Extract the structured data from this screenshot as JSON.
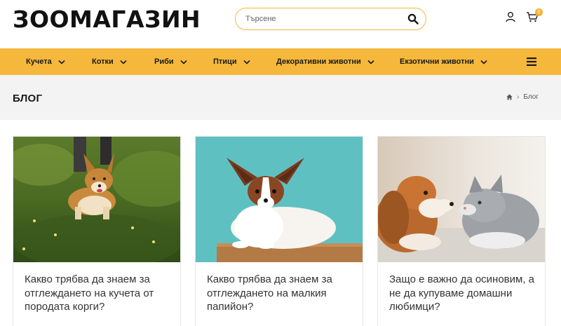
{
  "header": {
    "logo": "ЗООМАГАЗИН",
    "search": {
      "placeholder": "Търсене"
    },
    "cart_count": "0",
    "icons": {
      "search": "search-icon",
      "user": "user-icon",
      "cart": "cart-icon"
    }
  },
  "nav": {
    "items": [
      {
        "label": "Кучета"
      },
      {
        "label": "Котки"
      },
      {
        "label": "Риби"
      },
      {
        "label": "Птици"
      },
      {
        "label": "Декоративни животни"
      },
      {
        "label": "Екзотични животни"
      }
    ],
    "menu_icon": "hamburger-menu-icon"
  },
  "page": {
    "title": "БЛОГ",
    "breadcrumb": {
      "home_icon": "home-icon",
      "separator": "›",
      "current": "Блог"
    }
  },
  "posts": [
    {
      "title": "Какво трябва да знаем за отглеждането на кучета от породата корги?",
      "image": "corgi photo"
    },
    {
      "title": "Какво трябва да знаем за отглеждането на малкия папийон?",
      "image": "papillon photo"
    },
    {
      "title": "Защо е важно да осиновим, а не да купуваме домашни любимци?",
      "image": "dog and cat photo"
    }
  ],
  "colors": {
    "accent": "#f5b83d",
    "band": "#f3f3f3",
    "text": "#1a1a1a"
  }
}
